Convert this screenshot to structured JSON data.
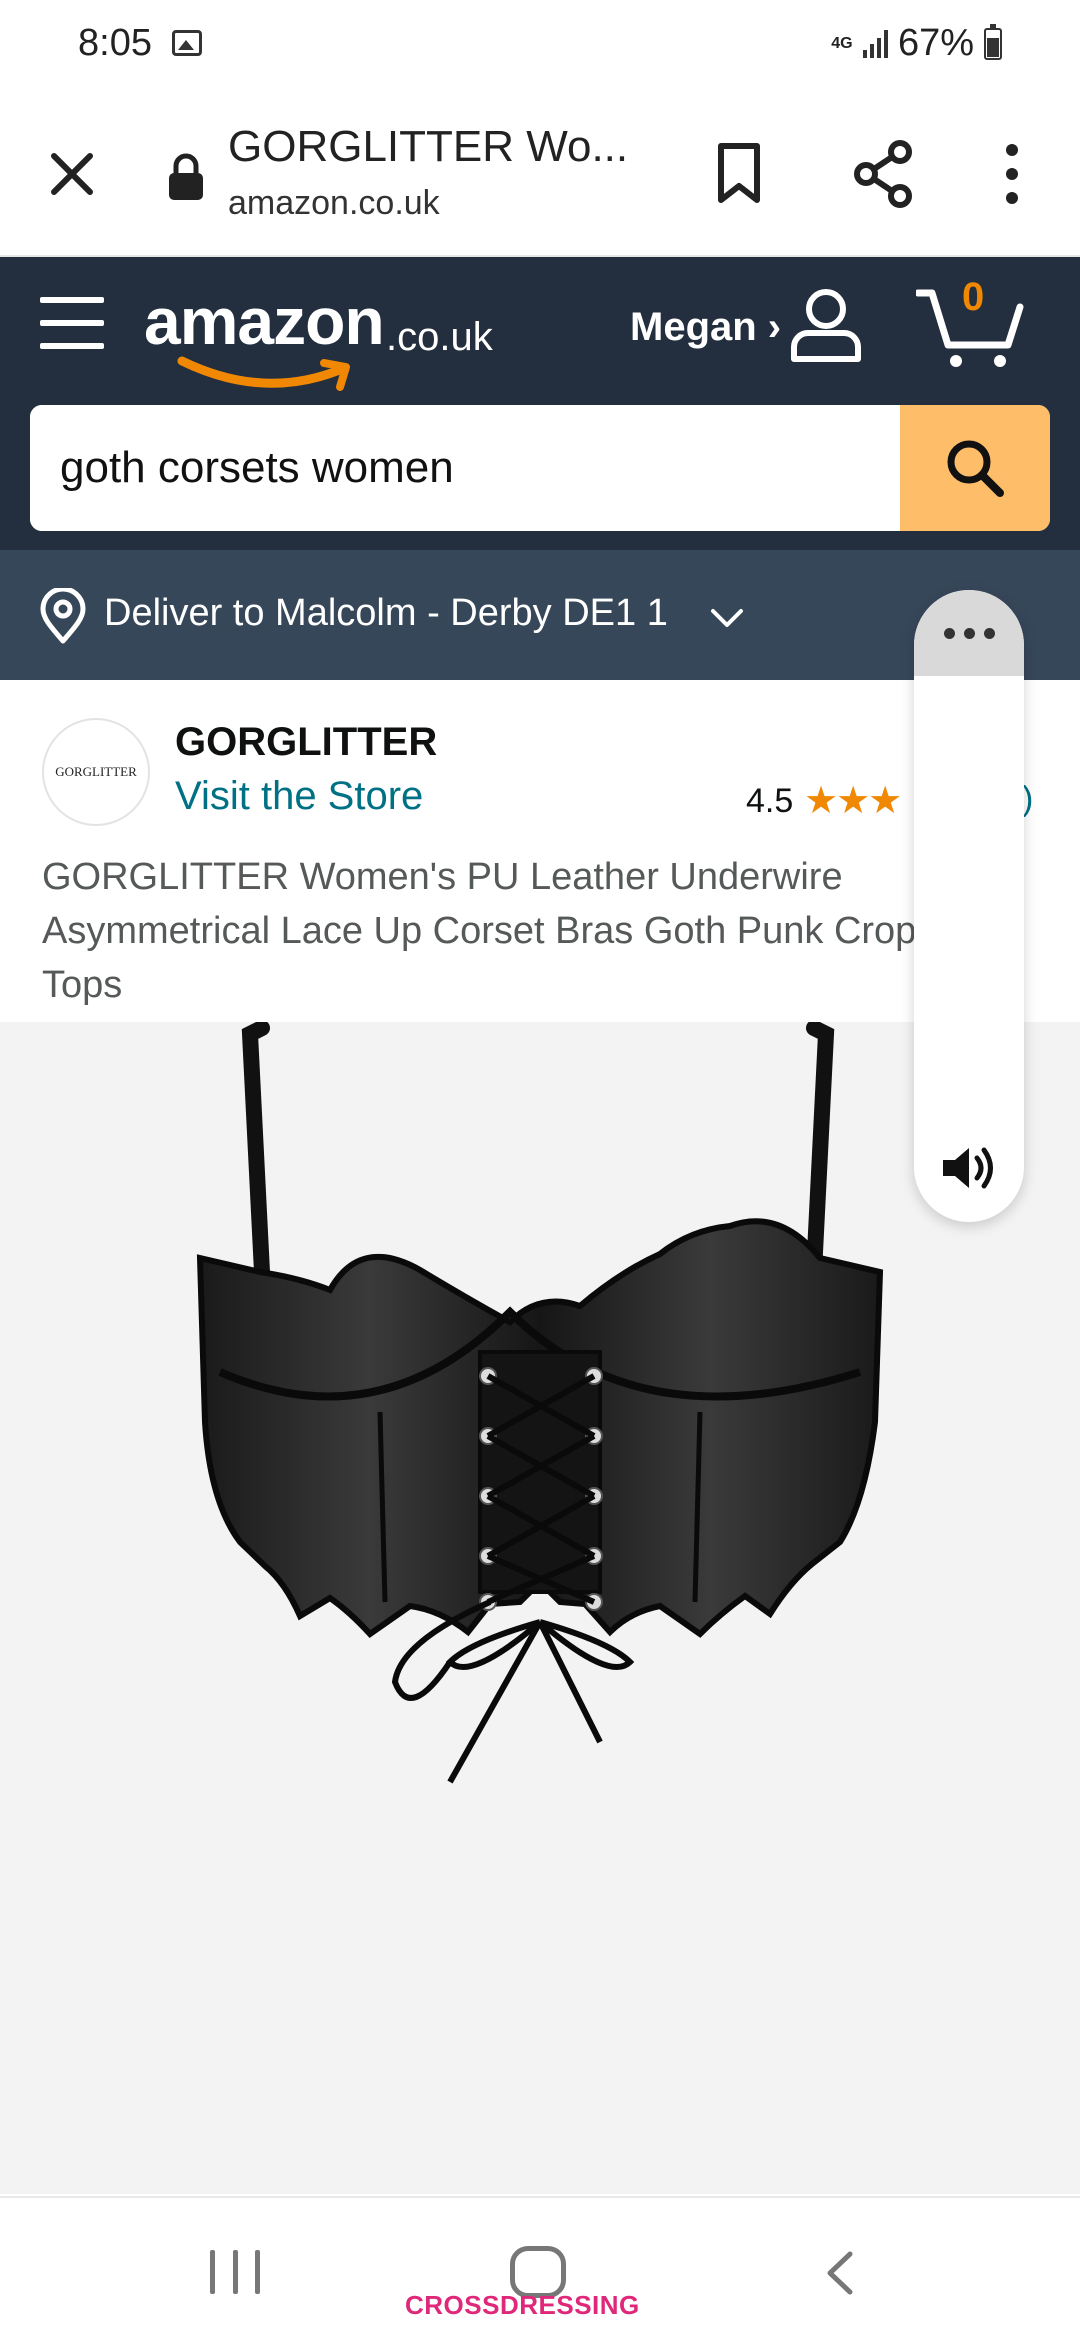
{
  "status_bar": {
    "time": "8:05",
    "network": "4G",
    "battery": "67%",
    "icons": [
      "gallery-icon",
      "signal-icon",
      "battery-icon"
    ]
  },
  "browser": {
    "title": "GORGLITTER Wo...",
    "domain": "amazon.co.uk",
    "icons": [
      "close-icon",
      "lock-icon",
      "bookmark-icon",
      "share-icon",
      "more-vert-icon"
    ]
  },
  "header": {
    "logo_word": "amazon",
    "logo_tld": ".co.uk",
    "account_name": "Megan ›",
    "cart_count": "0",
    "colors": {
      "header_bg": "#232f3e",
      "delivery_bg": "#37475a",
      "search_button": "#febd69",
      "accent": "#f08804"
    }
  },
  "search": {
    "value": "goth corsets women"
  },
  "delivery": {
    "text": "Deliver to Malcolm - Derby DE1 1"
  },
  "store": {
    "logo_text": "GORGLITTER",
    "name": "GORGLITTER",
    "visit_link": "Visit the Store",
    "rating": "4.5",
    "stars_display": "★★★",
    "rating_count_tail": ")"
  },
  "product": {
    "title": "GORGLITTER Women's PU Leather Underwire Asymmetrical Lace Up Corset Bras Goth Punk Crop Tops"
  },
  "floating_panel": {
    "icons": [
      "more-horiz-icon",
      "speaker-icon"
    ]
  },
  "nav_bar": {
    "watermark": "CROSSDRESSING",
    "icons": [
      "recent-apps-icon",
      "home-icon",
      "back-icon"
    ]
  }
}
